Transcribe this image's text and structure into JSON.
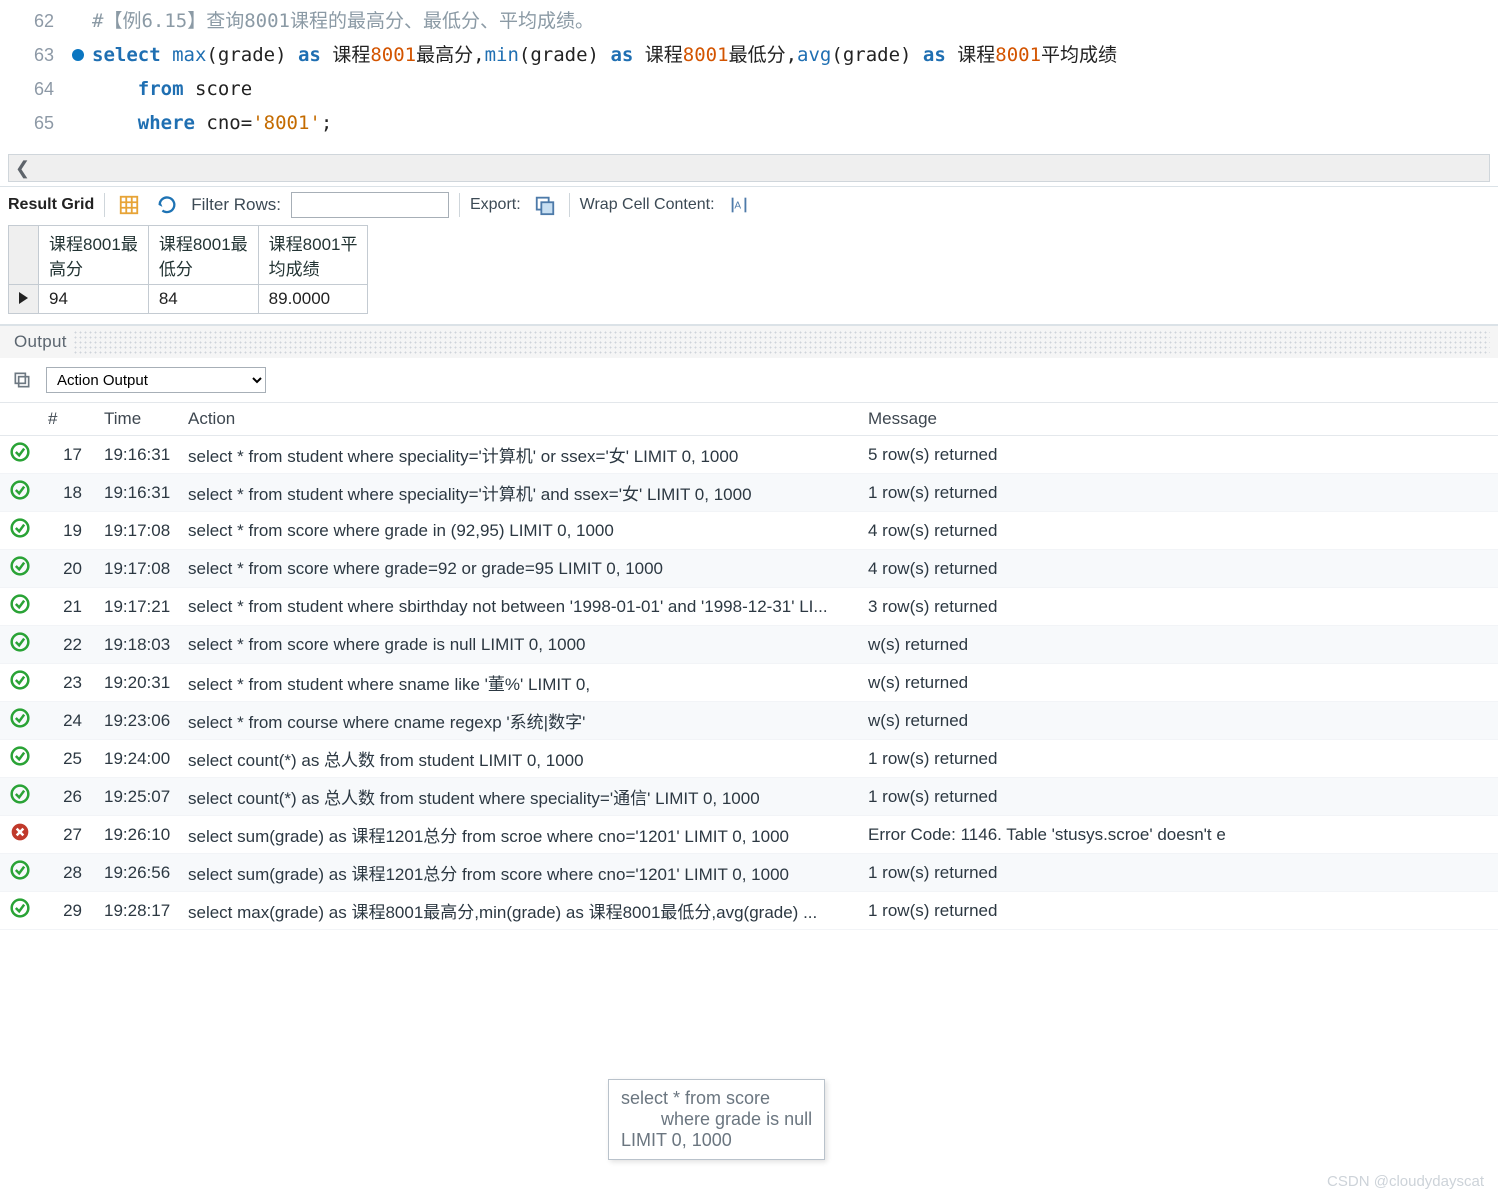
{
  "editor": {
    "lines": [
      {
        "num": "62",
        "bp": false
      },
      {
        "num": "63",
        "bp": true
      },
      {
        "num": "64",
        "bp": false
      },
      {
        "num": "65",
        "bp": false
      }
    ],
    "tokens": {
      "comment62": "#【例6.15】查询8001课程的最高分、最低分、平均成绩。",
      "select": "select",
      "max": "max",
      "min": "min",
      "avg": "avg",
      "grade": "grade",
      "as": "as",
      "col1l": " 课程",
      "n8001": "8001",
      "col1r": "最高分",
      "col2r": "最低分",
      "col3r": "平均成绩",
      "from": "from",
      "score": "score",
      "where": "where",
      "cno": "cno",
      "eq": "=",
      "lit8001": "'8001'",
      "semi": ";",
      "lp": "(",
      "rp": ")",
      "comma": ","
    }
  },
  "scroll_left_glyph": "❮",
  "result_toolbar": {
    "label": "Result Grid",
    "filter_label": "Filter Rows:",
    "filter_value": "",
    "export_label": "Export:",
    "wrap_label": "Wrap Cell Content:"
  },
  "result_columns": [
    "课程8001最高分",
    "课程8001最低分",
    "课程8001平均成绩"
  ],
  "result_rows": [
    [
      "94",
      "84",
      "89.0000"
    ]
  ],
  "output": {
    "title": "Output",
    "select_label": "Action Output",
    "columns": [
      "#",
      "Time",
      "Action",
      "Message"
    ],
    "rows": [
      {
        "status": "ok",
        "num": "17",
        "time": "19:16:31",
        "action": "select * from student where speciality='计算机' or ssex='女' LIMIT 0, 1000",
        "msg": "5 row(s) returned"
      },
      {
        "status": "ok",
        "num": "18",
        "time": "19:16:31",
        "action": "select * from student where speciality='计算机' and ssex='女' LIMIT 0, 1000",
        "msg": "1 row(s) returned"
      },
      {
        "status": "ok",
        "num": "19",
        "time": "19:17:08",
        "action": "select * from score where grade in (92,95) LIMIT 0, 1000",
        "msg": "4 row(s) returned"
      },
      {
        "status": "ok",
        "num": "20",
        "time": "19:17:08",
        "action": "select * from score where grade=92 or grade=95 LIMIT 0, 1000",
        "msg": "4 row(s) returned"
      },
      {
        "status": "ok",
        "num": "21",
        "time": "19:17:21",
        "action": "select * from student where sbirthday not between '1998-01-01' and '1998-12-31' LI...",
        "msg": "3 row(s) returned"
      },
      {
        "status": "ok",
        "num": "22",
        "time": "19:18:03",
        "action": "select * from score where grade is null LIMIT 0, 1000",
        "msg": "w(s) returned"
      },
      {
        "status": "ok",
        "num": "23",
        "time": "19:20:31",
        "action": "select * from student where sname like '董%' LIMIT 0,",
        "msg": "w(s) returned"
      },
      {
        "status": "ok",
        "num": "24",
        "time": "19:23:06",
        "action": "select * from course where cname regexp '系统|数字'",
        "msg": "w(s) returned"
      },
      {
        "status": "ok",
        "num": "25",
        "time": "19:24:00",
        "action": "select count(*) as 总人数 from student LIMIT 0, 1000",
        "msg": "1 row(s) returned"
      },
      {
        "status": "ok",
        "num": "26",
        "time": "19:25:07",
        "action": "select count(*) as 总人数 from student  where speciality='通信' LIMIT 0, 1000",
        "msg": "1 row(s) returned"
      },
      {
        "status": "err",
        "num": "27",
        "time": "19:26:10",
        "action": "select sum(grade) as 课程1201总分 from scroe where cno='1201' LIMIT 0, 1000",
        "msg": "Error Code: 1146. Table 'stusys.scroe' doesn't e"
      },
      {
        "status": "ok",
        "num": "28",
        "time": "19:26:56",
        "action": "select sum(grade) as 课程1201总分 from score where cno='1201' LIMIT 0, 1000",
        "msg": "1 row(s) returned"
      },
      {
        "status": "ok",
        "num": "29",
        "time": "19:28:17",
        "action": "select max(grade) as 课程8001最高分,min(grade) as 课程8001最低分,avg(grade) ...",
        "msg": "1 row(s) returned"
      }
    ],
    "tooltip": "select * from score\n        where grade is null\nLIMIT 0, 1000"
  },
  "watermark": "CSDN @cloudydayscat"
}
